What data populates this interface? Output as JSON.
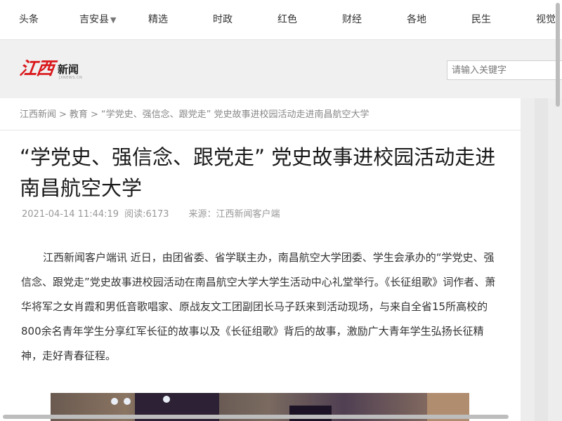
{
  "nav": {
    "items": [
      {
        "label": "头条"
      },
      {
        "label": "吉安县",
        "dropdown": true
      },
      {
        "label": "精选"
      },
      {
        "label": "时政"
      },
      {
        "label": "红色"
      },
      {
        "label": "财经"
      },
      {
        "label": "各地"
      },
      {
        "label": "民生"
      },
      {
        "label": "视觉"
      }
    ],
    "caret_glyph": "▼"
  },
  "header": {
    "logo_mark": "江西",
    "logo_text": "新闻",
    "logo_sub": "JXNEWS.CN",
    "search_placeholder": "请输入关键字"
  },
  "breadcrumb": {
    "items": [
      "江西新闻",
      "教育",
      "“学党史、强信念、跟党走” 党史故事进校园活动走进南昌航空大学"
    ],
    "separator": ">"
  },
  "article": {
    "title": "“学党史、强信念、跟党走” 党史故事进校园活动走进南昌航空大学",
    "datetime": "2021-04-14 11:44:19",
    "views": "阅读:6173",
    "source": "来源：江西新闻客户端",
    "paragraph": "江西新闻客户端讯 近日，由团省委、省学联主办，南昌航空大学团委、学生会承办的“学党史、强信念、跟党走”党史故事进校园活动在南昌航空大学大学生活动中心礼堂举行。《长征组歌》词作者、萧华将军之女肖霞和男低音歌唱家、原战友文工团副团长马子跃来到活动现场，与来自全省15所高校的800余名青年学生分享红军长征的故事以及《长征组歌》背后的故事，激励广大青年学生弘扬长征精神，走好青春征程。"
  },
  "colors": {
    "logo_red": "#d9171b",
    "header_bg": "#f0f0f0",
    "text_main": "#333333",
    "text_muted": "#999999"
  }
}
